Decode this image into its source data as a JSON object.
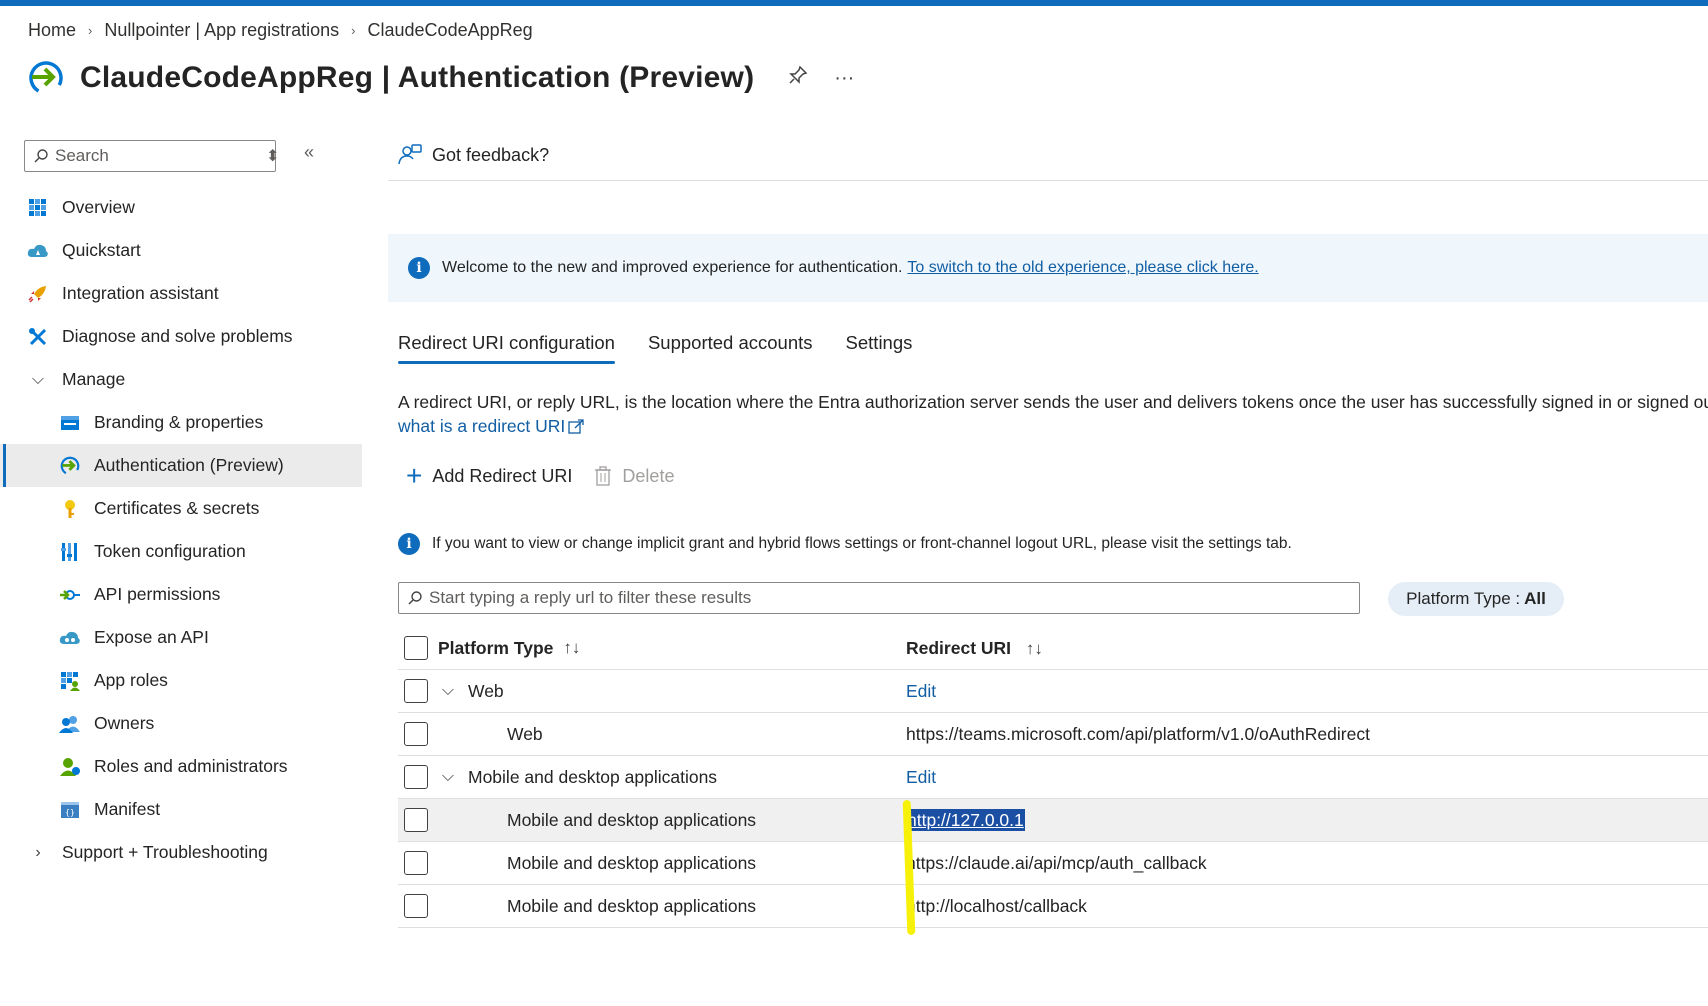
{
  "breadcrumb": [
    "Home",
    "Nullpointer | App registrations",
    "ClaudeCodeAppReg"
  ],
  "title": "ClaudeCodeAppReg | Authentication (Preview)",
  "title_actions": {
    "pin": "pin-icon",
    "more": "···"
  },
  "sidebar": {
    "search_placeholder": "Search",
    "collapse": "«",
    "sort": "⌃⌄",
    "items": [
      {
        "label": "Overview",
        "icon": "overview-icon"
      },
      {
        "label": "Quickstart",
        "icon": "quickstart-icon"
      },
      {
        "label": "Integration assistant",
        "icon": "rocket-icon"
      },
      {
        "label": "Diagnose and solve problems",
        "icon": "tools-icon"
      },
      {
        "label": "Manage",
        "icon": "chevron-down-icon"
      },
      {
        "label": "Branding & properties",
        "icon": "branding-icon"
      },
      {
        "label": "Authentication (Preview)",
        "icon": "authentication-icon",
        "active": true
      },
      {
        "label": "Certificates & secrets",
        "icon": "key-icon"
      },
      {
        "label": "Token configuration",
        "icon": "token-icon"
      },
      {
        "label": "API permissions",
        "icon": "api-permissions-icon"
      },
      {
        "label": "Expose an API",
        "icon": "cloud-icon"
      },
      {
        "label": "App roles",
        "icon": "app-roles-icon"
      },
      {
        "label": "Owners",
        "icon": "owners-icon"
      },
      {
        "label": "Roles and administrators",
        "icon": "roles-icon"
      },
      {
        "label": "Manifest",
        "icon": "manifest-icon"
      },
      {
        "label": "Support + Troubleshooting",
        "icon": "chevron-right-icon"
      }
    ]
  },
  "main": {
    "feedback": "Got feedback?",
    "info": {
      "text": "Welcome to the new and improved experience for authentication.",
      "link": "To switch to the old experience, please click here."
    },
    "tabs": [
      "Redirect URI configuration",
      "Supported accounts",
      "Settings"
    ],
    "description": "A redirect URI, or reply URL, is the location where the Entra authorization server sends the user and delivers tokens once the user has successfully signed in or signed out.",
    "description_link": "what is a redirect URI",
    "toolbar": {
      "add": "Add Redirect URI",
      "delete": "Delete"
    },
    "note": "If you want to view or change implicit grant and hybrid flows settings or front-channel logout URL, please visit the settings tab.",
    "filter_placeholder": "Start typing a reply url to filter these results",
    "platform_filter": {
      "label": "Platform Type :",
      "value": "All"
    },
    "table": {
      "headers": [
        "Platform Type",
        "Redirect URI"
      ],
      "sort_icon": "↑↓",
      "rows": [
        {
          "type": "Web",
          "group": true,
          "uri": "Edit"
        },
        {
          "type": "Web",
          "group": false,
          "uri": "https://teams.microsoft.com/api/platform/v1.0/oAuthRedirect"
        },
        {
          "type": "Mobile and desktop applications",
          "group": true,
          "uri": "Edit"
        },
        {
          "type": "Mobile and desktop applications",
          "group": false,
          "uri": "http://127.0.0.1",
          "selected": true
        },
        {
          "type": "Mobile and desktop applications",
          "group": false,
          "uri": "https://claude.ai/api/mcp/auth_callback"
        },
        {
          "type": "Mobile and desktop applications",
          "group": false,
          "uri": "http://localhost/callback"
        }
      ]
    }
  },
  "colors": {
    "accent": "#0f6cbd",
    "link": "#115ea3",
    "info_bg": "#eff6fc",
    "highlight_marker": "#f7f10a"
  }
}
